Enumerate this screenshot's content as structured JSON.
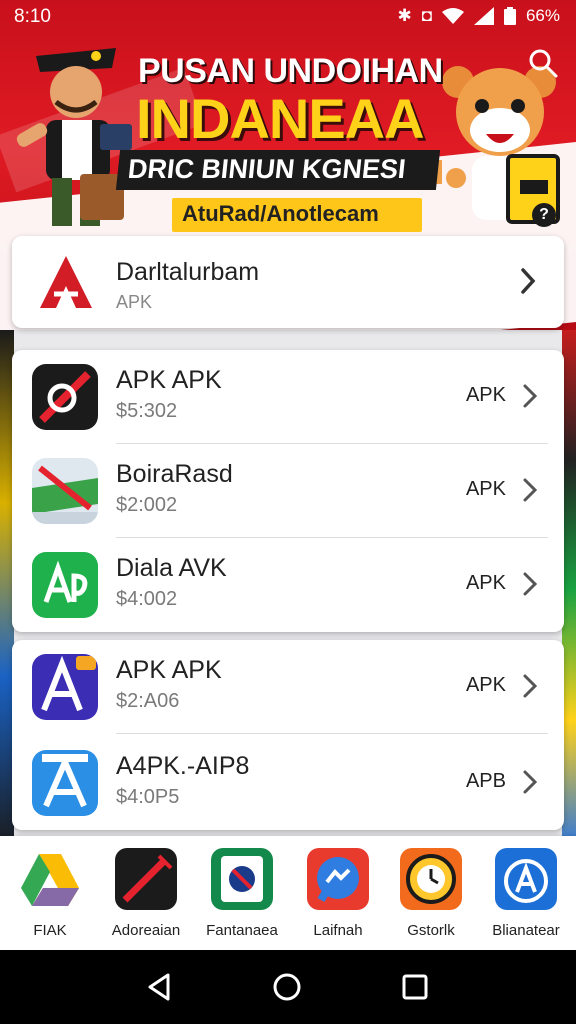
{
  "status_bar": {
    "time": "8:10",
    "battery": "66%",
    "icons": [
      "bluetooth-icon",
      "vibrate-icon",
      "wifi-icon",
      "signal-icon",
      "battery-icon"
    ]
  },
  "banner": {
    "line1": "PUSAN UNDOIHAN",
    "line2": "INDANEAA",
    "line3": "DRIC BINIUN KGNESI",
    "pill": "AtuRad/Anotlecam",
    "help_label": "?",
    "colors": {
      "primary": "#e01b24",
      "accent": "#ffd21a"
    }
  },
  "featured": {
    "name": "Darltalurbam",
    "subtitle": "APK"
  },
  "list_one": [
    {
      "title": "APK APK",
      "price": "$5:302",
      "tag": "APK",
      "icon": "black-red-app-icon"
    },
    {
      "title": "BoiraRasd",
      "price": "$2:002",
      "tag": "APK",
      "icon": "map-app-icon"
    },
    {
      "title": "Diala AVK",
      "price": "$4:002",
      "tag": "APK",
      "icon": "green-ap-icon"
    }
  ],
  "list_two": [
    {
      "title": "APK APK",
      "price": "$2:A06",
      "tag": "APK",
      "icon": "purple-a-app-icon"
    },
    {
      "title": "A4PK.-AIP8",
      "price": "$4:0P5",
      "tag": "APB",
      "icon": "blue-a-app-icon"
    }
  ],
  "dock": [
    {
      "label": "FIAK",
      "icon": "drive-icon"
    },
    {
      "label": "Adoreaian",
      "icon": "pen-app-icon"
    },
    {
      "label": "Fantanaea",
      "icon": "green-badge-icon"
    },
    {
      "label": "Laifnah",
      "icon": "messenger-icon"
    },
    {
      "label": "Gstorlk",
      "icon": "clock-gear-icon"
    },
    {
      "label": "Blianatear",
      "icon": "blue-a-store-icon"
    }
  ],
  "navbar": [
    "back-icon",
    "home-icon",
    "recents-icon"
  ]
}
